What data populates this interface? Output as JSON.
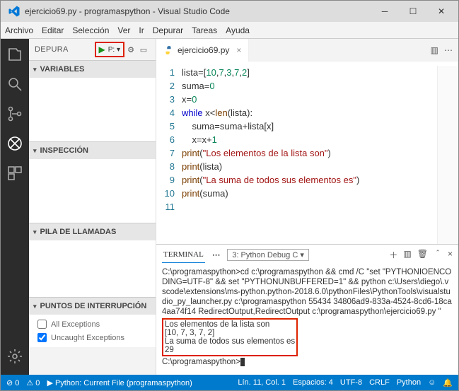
{
  "window": {
    "title": "ejercicio69.py - programaspython - Visual Studio Code"
  },
  "menu": {
    "items": [
      "Archivo",
      "Editar",
      "Selección",
      "Ver",
      "Ir",
      "Depurar",
      "Tareas",
      "Ayuda"
    ]
  },
  "sidebar": {
    "title": "DEPURA",
    "runconfig": "P: ▾",
    "sections": {
      "variables": "VARIABLES",
      "inspeccion": "INSPECCIÓN",
      "pila": "PILA DE LLAMADAS",
      "puntos": "PUNTOS DE INTERRUPCIÓN"
    },
    "breakpoints": {
      "all": "All Exceptions",
      "uncaught": "Uncaught Exceptions"
    }
  },
  "tab": {
    "name": "ejercicio69.py"
  },
  "code": {
    "lines": [
      {
        "n": "1",
        "pre": "",
        "c": [
          "lista",
          {
            "op": "="
          },
          "[",
          {
            "num": "10"
          },
          ",",
          {
            "num": "7"
          },
          ",",
          {
            "num": "3"
          },
          ",",
          {
            "num": "7"
          },
          ",",
          {
            "num": "2"
          },
          "]"
        ]
      },
      {
        "n": "2",
        "pre": "",
        "c": [
          "suma",
          {
            "op": "="
          },
          {
            "num": "0"
          }
        ]
      },
      {
        "n": "3",
        "pre": "",
        "c": [
          "x",
          {
            "op": "="
          },
          {
            "num": "0"
          }
        ]
      },
      {
        "n": "4",
        "pre": "",
        "c": [
          {
            "kw": "while"
          },
          " x",
          {
            "op": "<"
          },
          {
            "fn": "len"
          },
          "(lista):"
        ]
      },
      {
        "n": "5",
        "pre": "    ",
        "c": [
          "suma",
          {
            "op": "="
          },
          "suma",
          {
            "op": "+"
          },
          "lista[x]"
        ]
      },
      {
        "n": "6",
        "pre": "    ",
        "c": [
          "x",
          {
            "op": "="
          },
          "x",
          {
            "op": "+"
          },
          {
            "num": "1"
          }
        ]
      },
      {
        "n": "7",
        "pre": "",
        "c": [
          {
            "fn": "print"
          },
          "(",
          {
            "str": "\"Los elementos de la lista son\""
          },
          ")"
        ]
      },
      {
        "n": "8",
        "pre": "",
        "c": [
          {
            "fn": "print"
          },
          "(lista)"
        ]
      },
      {
        "n": "9",
        "pre": "",
        "c": [
          {
            "fn": "print"
          },
          "(",
          {
            "str": "\"La suma de todos sus elementos es\""
          },
          ")"
        ]
      },
      {
        "n": "10",
        "pre": "",
        "c": [
          {
            "fn": "print"
          },
          "(suma)"
        ]
      },
      {
        "n": "11",
        "pre": "",
        "c": []
      }
    ]
  },
  "terminal": {
    "tab": "TERMINAL",
    "selector": "3: Python Debug C ▾",
    "cmd": "C:\\programaspython>cd c:\\programaspython && cmd /C \"set \"PYTHONIOENCODING=UTF-8\" && set \"PYTHONUNBUFFERED=1\" && python c:\\Users\\diego\\.vscode\\extensions\\ms-python.python-2018.6.0\\pythonFiles\\PythonTools\\visualstudio_py_launcher.py c:\\programaspython 55434 34806ad9-833a-4524-8cd6-18ca4aa74f14 RedirectOutput,RedirectOutput c:\\programaspython\\ejercicio69.py \"",
    "out1": "Los elementos de la lista son",
    "out2": "[10, 7, 3, 7, 2]",
    "out3": "La suma de todos sus elementos es",
    "out4": "29",
    "prompt": "C:\\programaspython>"
  },
  "status": {
    "errors": "⊘ 0",
    "warnings": "⚠ 0",
    "launch": "▶ Python: Current File (programaspython)",
    "line": "Lín. 11, Col. 1",
    "spaces": "Espacios: 4",
    "encoding": "UTF-8",
    "eol": "CRLF",
    "lang": "Python",
    "face": "☺",
    "bell": "🔔"
  }
}
